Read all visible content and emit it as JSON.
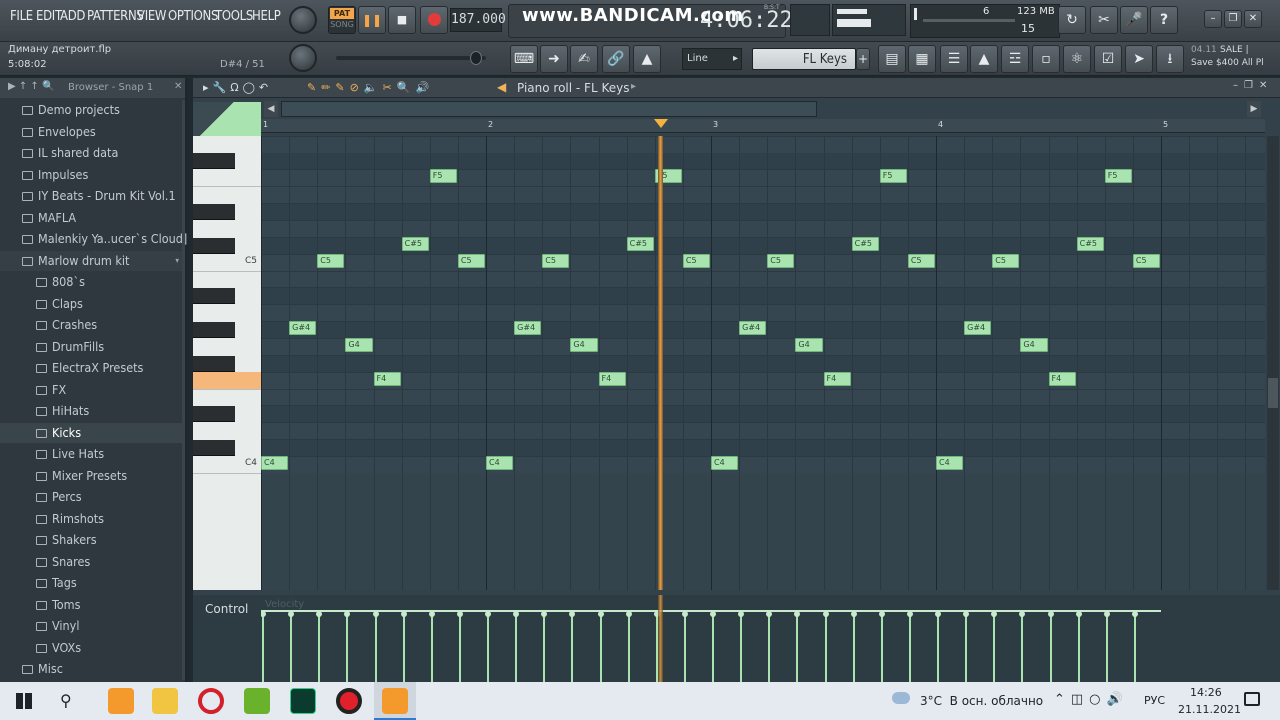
{
  "menu": [
    "FILE",
    "EDIT",
    "ADD",
    "PATTERNS",
    "VIEW",
    "OPTIONS",
    "TOOLS",
    "HELP"
  ],
  "project": {
    "file": "Диману детроит.flp",
    "time": "5:08:02",
    "hint": "D#4 / 51"
  },
  "transport": {
    "pat_label": "PAT",
    "song_label": "SONG",
    "tempo": "187.000",
    "position": "4:06:22",
    "bst": "B:S:T"
  },
  "watermark": "www.BANDICAM.com",
  "monitor": {
    "cpu": "6",
    "memory": "123 MB",
    "polyphony": "15"
  },
  "toolbar2": {
    "snap_mode": "Line",
    "instrument": "FL Keys"
  },
  "news": {
    "date": "04.11",
    "line1": "SALE |",
    "line2": "Save $400 All Pl"
  },
  "browser": {
    "title": "Browser - Snap 1",
    "items": [
      {
        "label": "Demo projects",
        "indent": 0
      },
      {
        "label": "Envelopes",
        "indent": 0
      },
      {
        "label": "IL shared data",
        "indent": 0
      },
      {
        "label": "Impulses",
        "indent": 0
      },
      {
        "label": "IY Beats - Drum Kit Vol.1",
        "indent": 0
      },
      {
        "label": "MAFLA",
        "indent": 0
      },
      {
        "label": "Malenkiy Ya..ucer`s Cloud]",
        "indent": 0
      },
      {
        "label": "Marlow drum kit",
        "indent": 0,
        "open": true
      },
      {
        "label": "808`s",
        "indent": 1
      },
      {
        "label": "Claps",
        "indent": 1
      },
      {
        "label": "Crashes",
        "indent": 1
      },
      {
        "label": "DrumFills",
        "indent": 1
      },
      {
        "label": "ElectraX Presets",
        "indent": 1
      },
      {
        "label": "FX",
        "indent": 1
      },
      {
        "label": "HiHats",
        "indent": 1
      },
      {
        "label": "Kicks",
        "indent": 1,
        "selected": true
      },
      {
        "label": "Live Hats",
        "indent": 1
      },
      {
        "label": "Mixer Presets",
        "indent": 1
      },
      {
        "label": "Percs",
        "indent": 1
      },
      {
        "label": "Rimshots",
        "indent": 1
      },
      {
        "label": "Shakers",
        "indent": 1
      },
      {
        "label": "Snares",
        "indent": 1
      },
      {
        "label": "Tags",
        "indent": 1
      },
      {
        "label": "Toms",
        "indent": 1
      },
      {
        "label": "Vinyl",
        "indent": 1
      },
      {
        "label": "VOXs",
        "indent": 1
      },
      {
        "label": "Misc",
        "indent": 0
      }
    ]
  },
  "piano_roll": {
    "title": "Piano roll - FL Keys",
    "bars": [
      "1",
      "2",
      "3",
      "4",
      "5"
    ],
    "key_labels": [
      "C5",
      "C4"
    ],
    "playhead_beat": 14.2,
    "notes": [
      {
        "pitch": "C4",
        "beat": 0.0
      },
      {
        "pitch": "G#4",
        "beat": 1.0
      },
      {
        "pitch": "C5",
        "beat": 2.0
      },
      {
        "pitch": "G4",
        "beat": 3.0
      },
      {
        "pitch": "F4",
        "beat": 4.0
      },
      {
        "pitch": "C#5",
        "beat": 5.0
      },
      {
        "pitch": "F5",
        "beat": 6.0
      },
      {
        "pitch": "C5",
        "beat": 7.0
      },
      {
        "pitch": "C4",
        "beat": 8.0
      },
      {
        "pitch": "G#4",
        "beat": 9.0
      },
      {
        "pitch": "C5",
        "beat": 10.0
      },
      {
        "pitch": "G4",
        "beat": 11.0
      },
      {
        "pitch": "F4",
        "beat": 12.0
      },
      {
        "pitch": "C#5",
        "beat": 13.0
      },
      {
        "pitch": "F5",
        "beat": 14.0
      },
      {
        "pitch": "C5",
        "beat": 15.0
      },
      {
        "pitch": "C4",
        "beat": 16.0
      },
      {
        "pitch": "G#4",
        "beat": 17.0
      },
      {
        "pitch": "C5",
        "beat": 18.0
      },
      {
        "pitch": "G4",
        "beat": 19.0
      },
      {
        "pitch": "F4",
        "beat": 20.0
      },
      {
        "pitch": "C#5",
        "beat": 21.0
      },
      {
        "pitch": "F5",
        "beat": 22.0
      },
      {
        "pitch": "C5",
        "beat": 23.0
      },
      {
        "pitch": "C4",
        "beat": 24.0
      },
      {
        "pitch": "G#4",
        "beat": 25.0
      },
      {
        "pitch": "C5",
        "beat": 26.0
      },
      {
        "pitch": "G4",
        "beat": 27.0
      },
      {
        "pitch": "F4",
        "beat": 28.0
      },
      {
        "pitch": "C#5",
        "beat": 29.0
      },
      {
        "pitch": "F5",
        "beat": 30.0
      },
      {
        "pitch": "C5",
        "beat": 31.0
      }
    ],
    "control_label": "Control",
    "control_param": "Velocity"
  },
  "taskbar": {
    "weather": "3°C  В осн. облачно",
    "lang": "РУС",
    "time": "14:26",
    "date": "21.11.2021"
  }
}
